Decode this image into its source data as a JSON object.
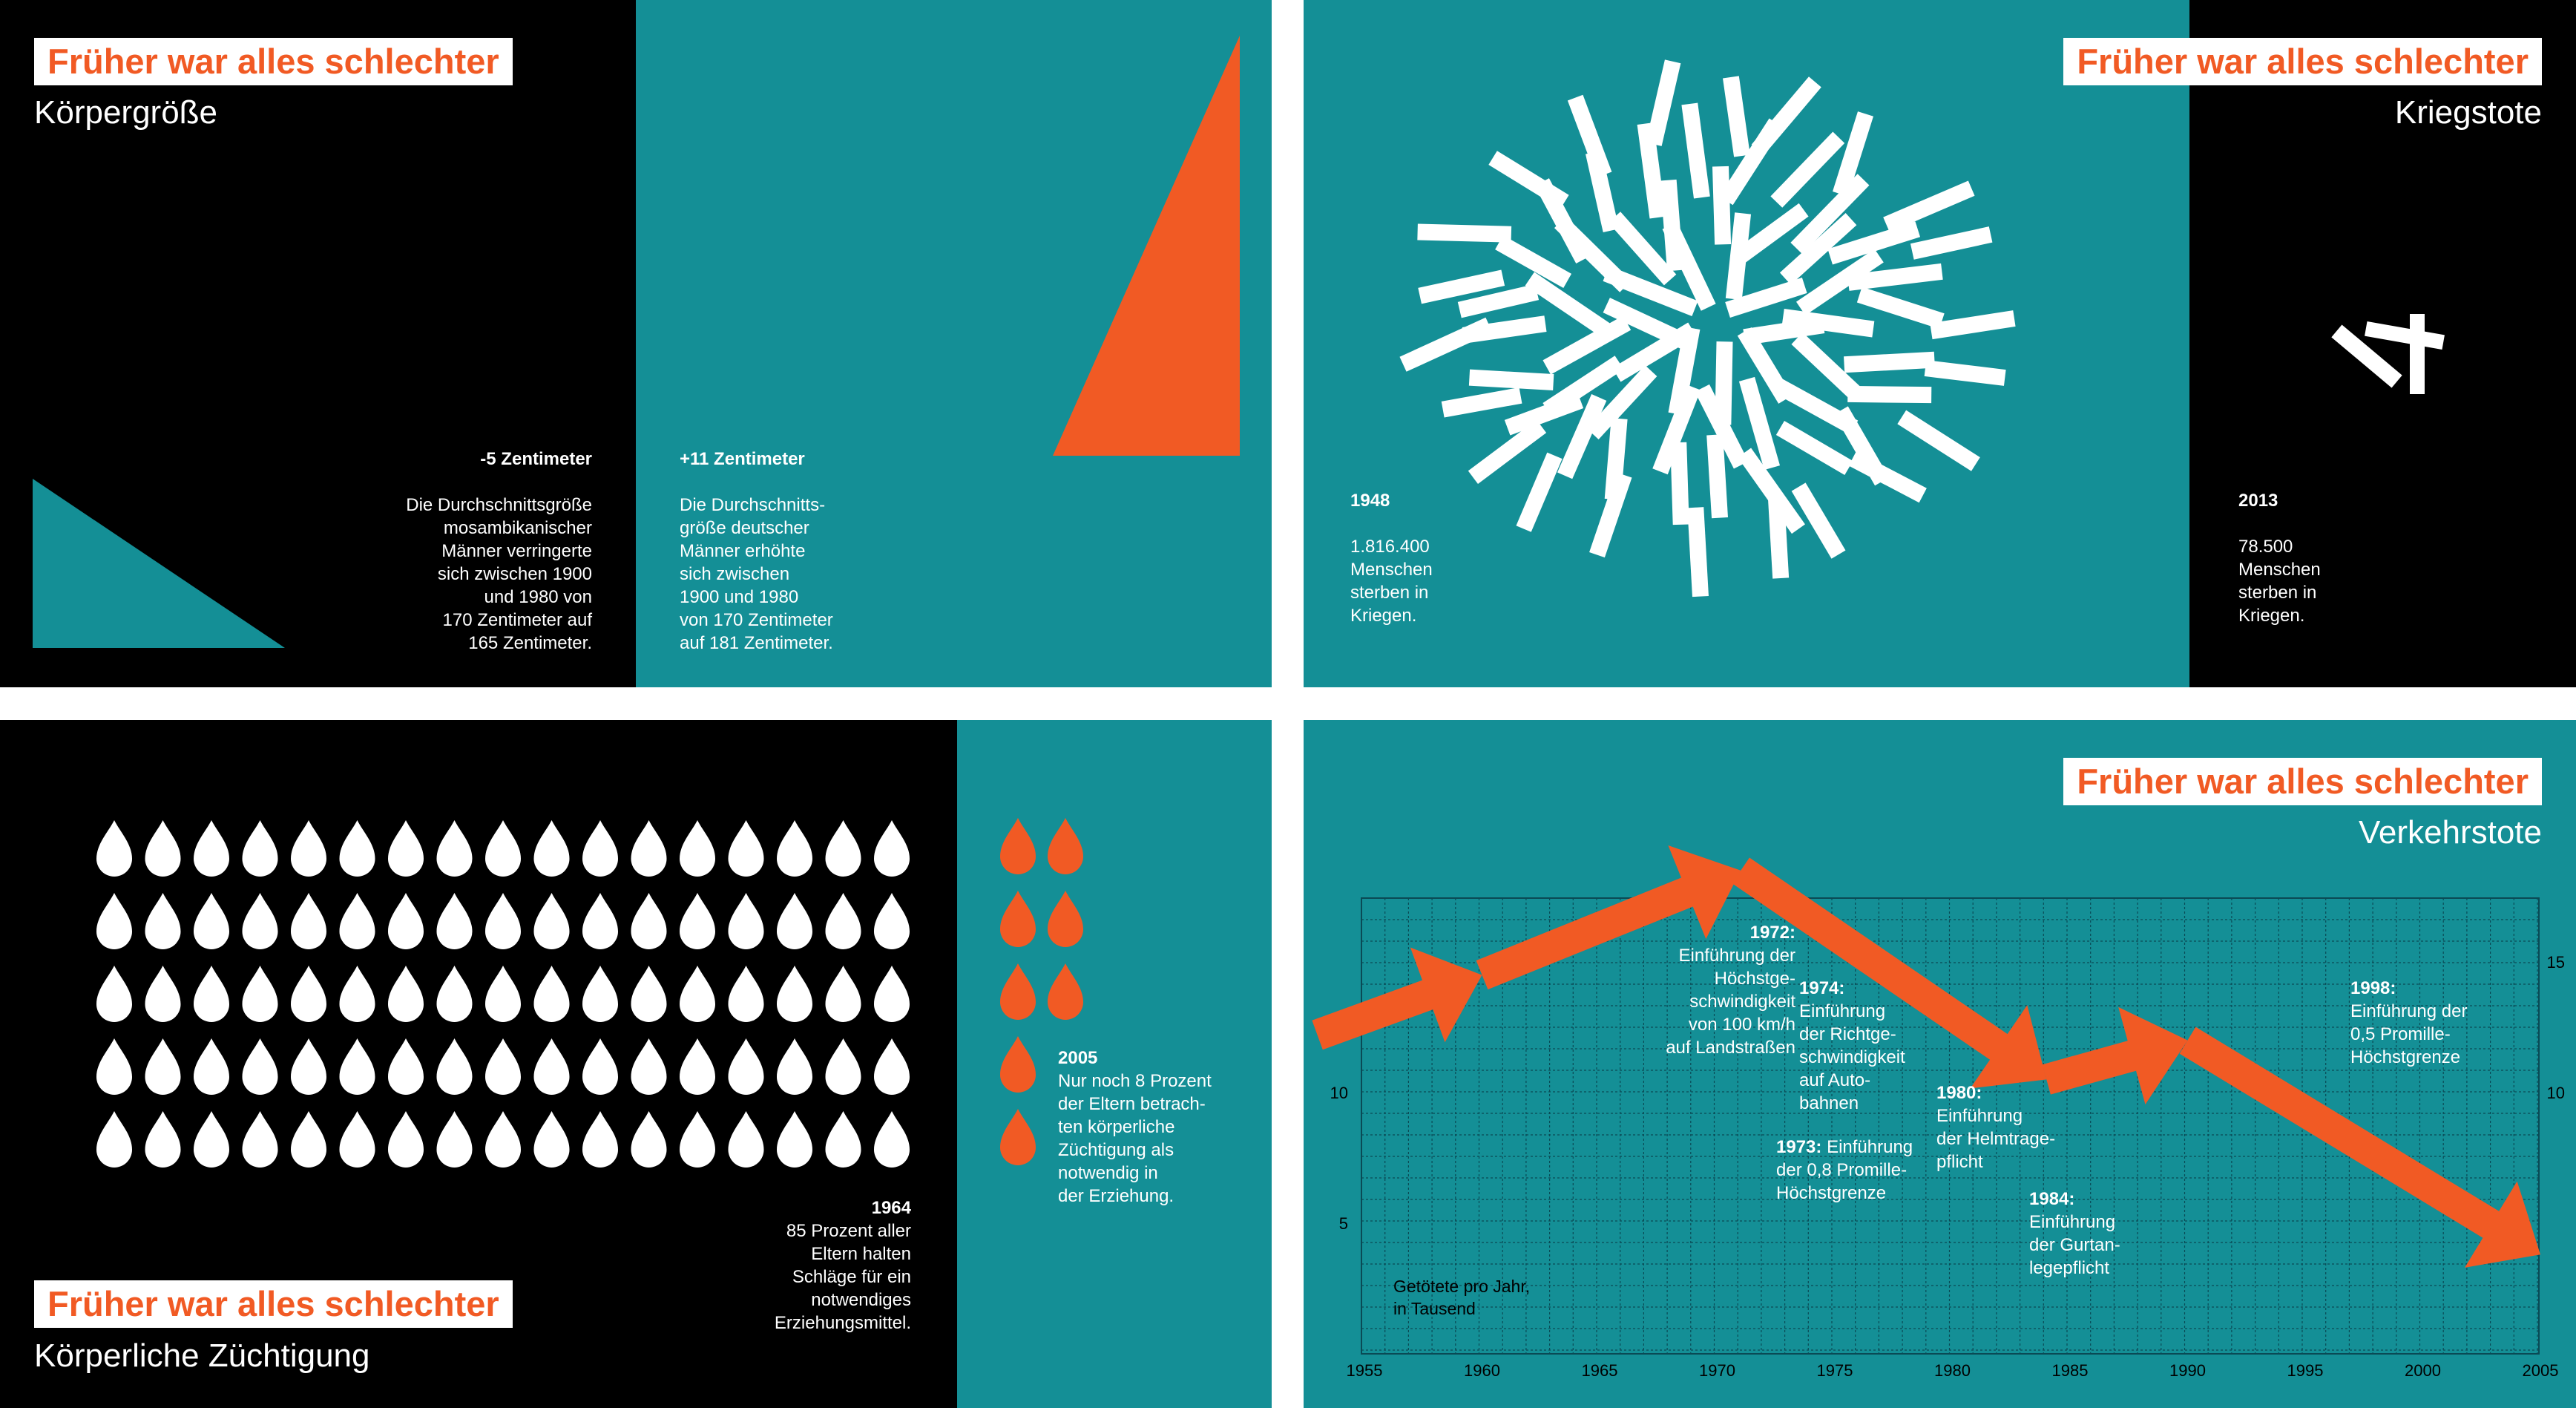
{
  "colors": {
    "teal": "#148f96",
    "black": "#000000",
    "orange": "#f15a24",
    "white": "#ffffff"
  },
  "series_title": "Früher war alles schlechter",
  "p1": {
    "subtitle": "Körpergröße",
    "left": {
      "heading": "-5 Zentimeter",
      "body": "Die Durchschnittsgröße\nmosambikanischer\nMänner verringerte\nsich zwischen 1900\nund  1980 von\n170 Zentimeter auf\n165 Zentimeter."
    },
    "right": {
      "heading": "+11 Zentimeter",
      "body": "Die Durchschnitts-\ngröße deutscher\nMänner erhöhte\nsich zwischen\n1900 und 1980\nvon 170 Zentimeter\nauf 181 Zentimeter."
    }
  },
  "p2": {
    "subtitle": "Kriegstote",
    "left": {
      "year": "1948",
      "body": "1.816.400\nMenschen\nsterben in\nKriegen."
    },
    "right": {
      "year": "2013",
      "body": "78.500\nMenschen\nsterben in\nKriegen."
    }
  },
  "p3": {
    "subtitle": "Körperliche Züchtigung",
    "left": {
      "year": "1964",
      "body": "85 Prozent aller\nEltern halten\nSchläge für ein\nnotwendiges\nErziehungsmittel."
    },
    "right": {
      "year": "2005",
      "body": "Nur noch 8 Prozent\nder Eltern betrach-\nten körperliche\nZüchtigung als\nnotwendig in\nder Erziehung."
    },
    "white_drops": 85,
    "orange_drops": 8
  },
  "p4": {
    "subtitle": "Verkehrstote",
    "y_caption": "Getötete pro Jahr,\nin Tausend",
    "annotations": [
      {
        "year": "1972:",
        "text": "Einführung der\nHöchstge-\nschwindigkeit\nvon 100 km/h\nauf Landstraßen"
      },
      {
        "year": "1974:",
        "text": "Einführung\nder Richtge-\nschwindigkeit\nauf Auto-\nbahnen"
      },
      {
        "year": "1973:",
        "text": "Einführung\nder 0,8 Promille-\nHöchstgrenze"
      },
      {
        "year": "1980:",
        "text": "Einführung\nder Helmtrage-\npflicht"
      },
      {
        "year": "1984:",
        "text": "Einführung\nder Gurtan-\nlegepflicht"
      },
      {
        "year": "1998:",
        "text": "Einführung der\n0,5 Promille-\nHöchstgrenze"
      }
    ]
  },
  "chart_data": {
    "type": "line",
    "title": "Verkehrstote",
    "ylabel": "Getötete pro Jahr, in Tausend",
    "x_ticks": [
      "1955",
      "1960",
      "1965",
      "1970",
      "1975",
      "1980",
      "1985",
      "1990",
      "1995",
      "2000",
      "2005"
    ],
    "y_ticks_left": [
      "5",
      "10"
    ],
    "y_ticks_right": [
      "10",
      "15"
    ],
    "xlim": [
      1954,
      2006
    ],
    "ylim": [
      0,
      17
    ],
    "series": [
      {
        "x": [
          1953,
          1960,
          1971,
          1984,
          1990,
          2005
        ],
        "y": [
          12.2,
          14.5,
          18.5,
          10.5,
          12.0,
          3.8
        ]
      }
    ]
  }
}
